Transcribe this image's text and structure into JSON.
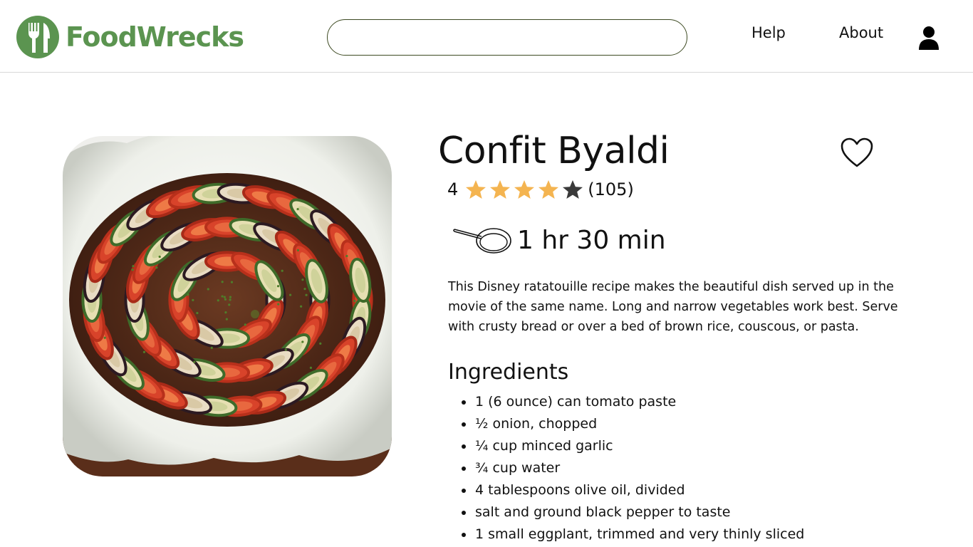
{
  "header": {
    "brand": "FoodWrecks",
    "search": {
      "placeholder": "",
      "value": ""
    },
    "nav": {
      "help": "Help",
      "about": "About"
    },
    "icons": {
      "logo": "fork-knife-icon",
      "account": "user-icon"
    }
  },
  "recipe": {
    "title": "Confit Byaldi",
    "rating": {
      "value": "4",
      "count": "(105)",
      "stars": 4,
      "max_stars": 5
    },
    "time": "1 hr 30 min",
    "description": "This Disney ratatouille recipe makes the beautiful dish served up in the movie of the same name. Long and narrow vegetables work best. Serve with crusty bread or over a bed of brown rice, couscous, or pasta.",
    "ingredients_title": "Ingredients",
    "ingredients": [
      "1 (6 ounce) can tomato paste",
      "½ onion, chopped",
      "¼ cup minced garlic",
      "¾ cup water",
      "4 tablespoons olive oil, divided",
      "salt and ground black pepper to taste",
      "1 small eggplant, trimmed and very thinly sliced"
    ]
  },
  "colors": {
    "brand_green": "#5b9450",
    "star_filled": "#f4b450",
    "star_empty": "#3a3a3a",
    "search_border": "#3d4a22"
  }
}
